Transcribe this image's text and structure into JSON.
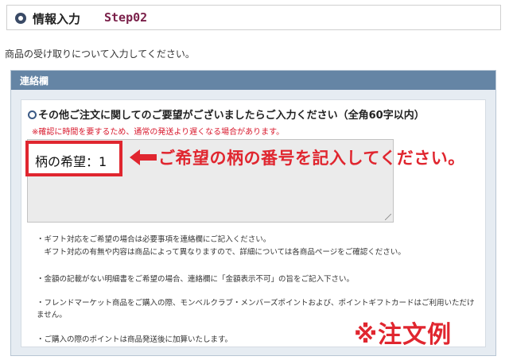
{
  "header": {
    "title": "情報入力",
    "step": "Step02"
  },
  "intro": "商品の受け取りについて入力してください。",
  "panel": {
    "title": "連絡欄",
    "question": "その他ご注文に関してのご要望がございましたらご入力ください（全角60字以内）",
    "note": "※確認に時間を要するため、通常の発送より遅くなる場合があります。",
    "textarea_value": "柄の希望：1"
  },
  "annotation": {
    "callout": "ご希望の柄の番号を記入してください。",
    "stamp": "※注文例",
    "accent_color": "#e0262f"
  },
  "notes": [
    "・ギフト対応をご希望の場合は必要事項を連絡欄にご記入ください。",
    "　ギフト対応の有無や内容は商品によって異なりますので、詳細については各商品ページをご確認ください。",
    "・金額の記載がない明細書をご希望の場合、連絡欄に「金額表示不可」の旨をご記入下さい。",
    "・フレンドマーケット商品をご購入の際、モンベルクラブ・メンバーズポイントおよび、ポイントギフトカードはご利用いただけません。",
    "・ご購入の際のポイントは商品発送後に加算いたします。"
  ]
}
